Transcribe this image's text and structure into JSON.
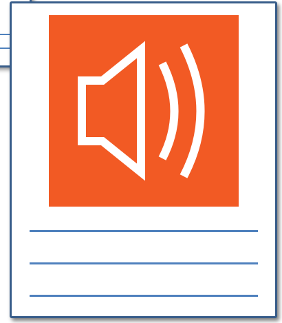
{
  "card": {
    "icon": "speaker-volume-icon",
    "line_count": 3
  },
  "colors": {
    "tile_background": "#f25a24",
    "icon_stroke": "#ffffff",
    "card_border": "#385d8a",
    "rule_line": "#4f81bd"
  }
}
